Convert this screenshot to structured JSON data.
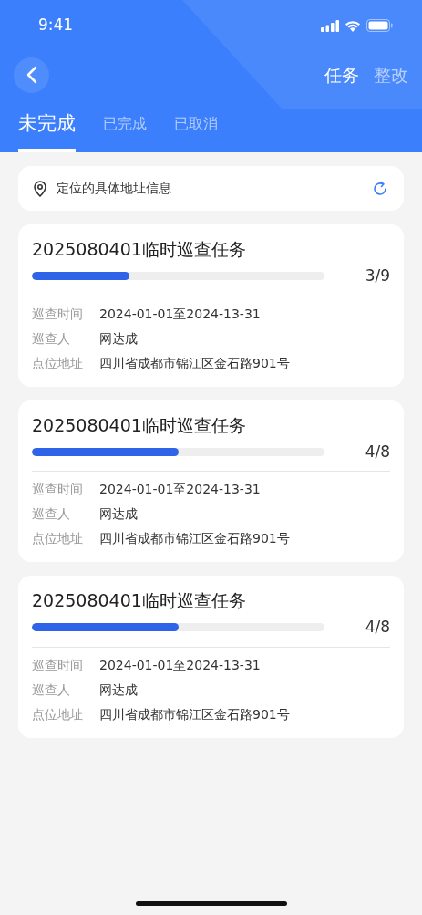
{
  "status_bar": {
    "time": "9:41"
  },
  "nav": {
    "actions": [
      {
        "label": "任务",
        "selected": true
      },
      {
        "label": "整改",
        "selected": false
      }
    ]
  },
  "tabs": [
    {
      "label": "未完成",
      "selected": true
    },
    {
      "label": "已完成",
      "selected": false
    },
    {
      "label": "已取消",
      "selected": false
    }
  ],
  "location": {
    "text": "定位的具体地址信息"
  },
  "tasks": [
    {
      "title": "2025080401临时巡查任务",
      "level": 0.333,
      "count": "3/9",
      "fields": [
        {
          "label": "巡查时间",
          "value": "2024-01-01至2024-13-31"
        },
        {
          "label": "巡查人",
          "value": "网达成"
        },
        {
          "label": "点位地址",
          "value": "四川省成都市锦江区金石路901号"
        }
      ]
    },
    {
      "title": "2025080401临时巡查任务",
      "level": 0.5,
      "count": "4/8",
      "fields": [
        {
          "label": "巡查时间",
          "value": "2024-01-01至2024-13-31"
        },
        {
          "label": "巡查人",
          "value": "网达成"
        },
        {
          "label": "点位地址",
          "value": "四川省成都市锦江区金石路901号"
        }
      ]
    },
    {
      "title": "2025080401临时巡查任务",
      "level": 0.5,
      "count": "4/8",
      "fields": [
        {
          "label": "巡查时间",
          "value": "2024-01-01至2024-13-31"
        },
        {
          "label": "巡查人",
          "value": "网达成"
        },
        {
          "label": "点位地址",
          "value": "四川省成都市锦江区金石路901号"
        }
      ]
    }
  ]
}
